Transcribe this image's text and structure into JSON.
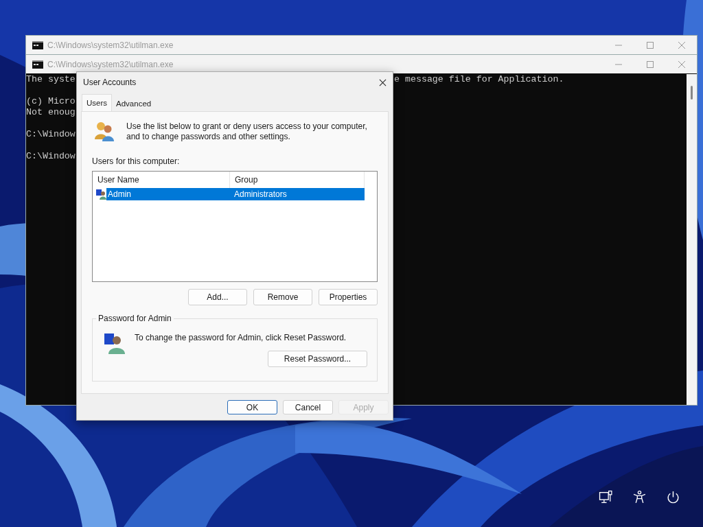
{
  "consoles": [
    {
      "title": "C:\\Windows\\system32\\utilman.exe"
    },
    {
      "title": "C:\\Windows\\system32\\utilman.exe",
      "paragraphs": [
        [
          "The syste"
        ],
        [
          "(c) Micro",
          "Not enoug"
        ],
        [
          "C:\\Window"
        ],
        [
          "C:\\Window"
        ]
      ],
      "right_text": "e message file for Application."
    }
  ],
  "dialog": {
    "title": "User Accounts",
    "tabs": [
      {
        "label": "Users",
        "selected": true
      },
      {
        "label": "Advanced",
        "selected": false
      }
    ],
    "intro": "Use the list below to grant or deny users access to your computer, and to change passwords and other settings.",
    "list_label": "Users for this computer:",
    "columns": [
      "User Name",
      "Group"
    ],
    "rows": [
      {
        "user_name": "Admin",
        "group": "Administrators",
        "selected": true
      }
    ],
    "list_buttons": [
      {
        "label": "Add...",
        "disabled": false
      },
      {
        "label": "Remove",
        "disabled": false
      },
      {
        "label": "Properties",
        "disabled": false
      }
    ],
    "password_group": {
      "title": "Password for Admin",
      "text": "To change the password for Admin, click Reset Password.",
      "button": "Reset Password..."
    },
    "buttons": [
      {
        "label": "OK",
        "default": true,
        "disabled": false
      },
      {
        "label": "Cancel",
        "default": false,
        "disabled": false
      },
      {
        "label": "Apply",
        "default": false,
        "disabled": true
      }
    ]
  },
  "system_icons": [
    {
      "kind": "network"
    },
    {
      "kind": "accessibility"
    },
    {
      "kind": "power"
    }
  ]
}
